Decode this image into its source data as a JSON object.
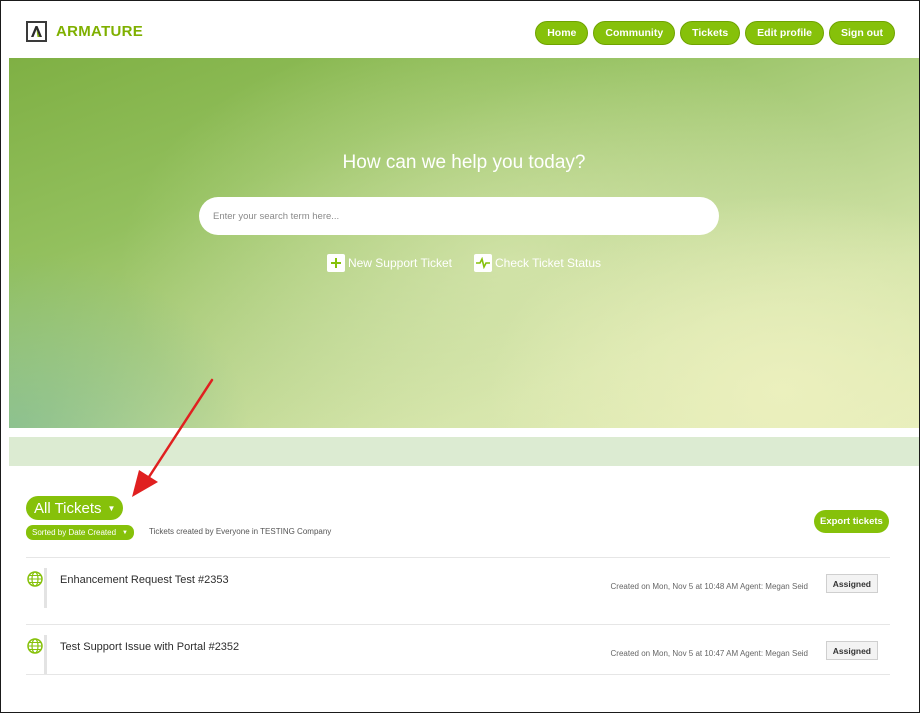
{
  "header": {
    "logo_letter": "A",
    "brand": "ARMATURE",
    "nav": [
      "Home",
      "Community",
      "Tickets",
      "Edit profile",
      "Sign out"
    ]
  },
  "hero": {
    "title": "How can we help you today?",
    "search_placeholder": "Enter your search term here...",
    "new_ticket": "New Support Ticket",
    "check_status": "Check Ticket Status"
  },
  "tickets": {
    "view_label": "All Tickets",
    "sort_label": "Sorted by Date Created",
    "filter_desc": "Tickets created by Everyone in TESTING Company",
    "export_label": "Export tickets",
    "rows": [
      {
        "title": "Enhancement Request Test #2353",
        "meta": "Created on Mon, Nov 5 at 10:48 AM Agent: Megan Seid",
        "status": "Assigned"
      },
      {
        "title": "Test Support Issue with Portal #2352",
        "meta": "Created on Mon, Nov 5 at 10:47 AM Agent: Megan Seid",
        "status": "Assigned"
      }
    ]
  },
  "colors": {
    "accent": "#86c10a",
    "annotation_arrow": "#e02020"
  },
  "icons": [
    "plus-icon",
    "pulse-icon",
    "globe-icon",
    "caret-down-icon"
  ]
}
